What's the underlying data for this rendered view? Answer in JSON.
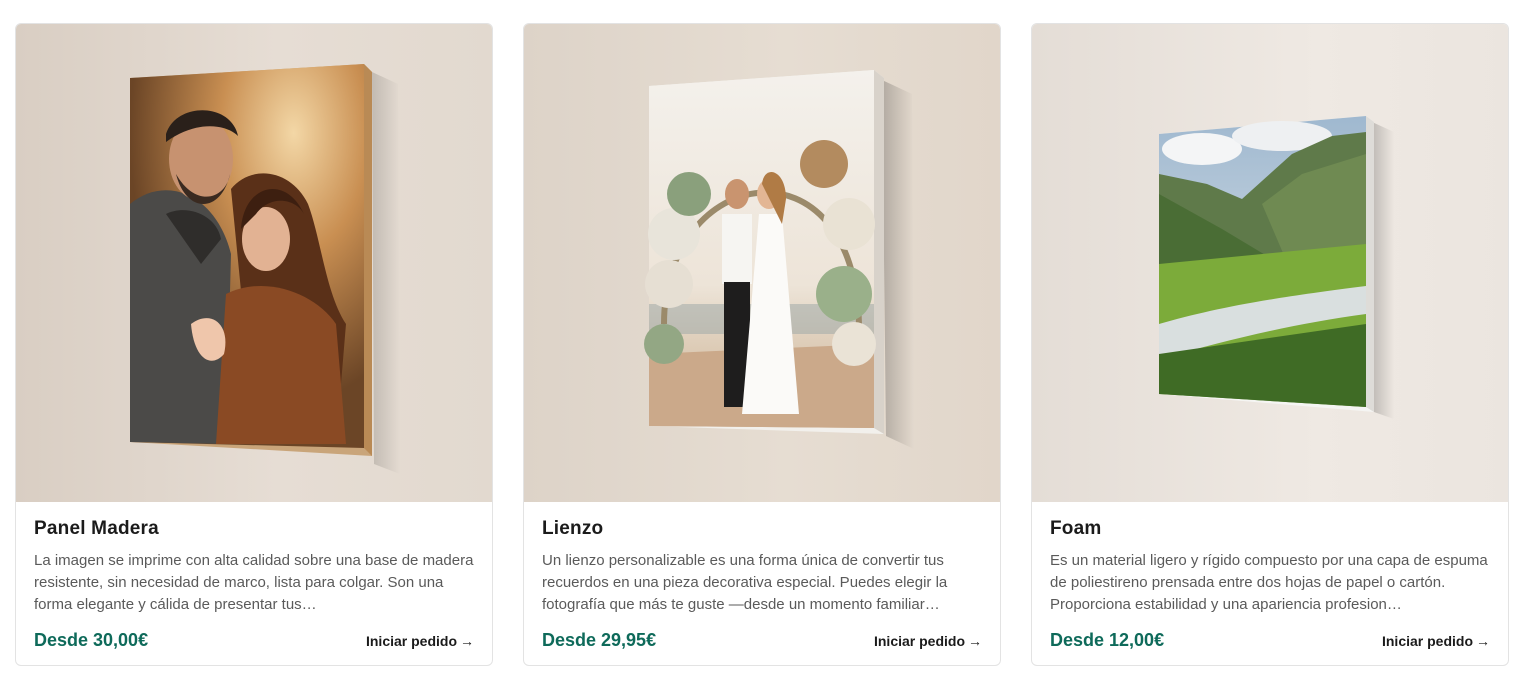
{
  "products": [
    {
      "title": "Panel Madera",
      "description": "La imagen se imprime con alta calidad sobre una base de madera resistente, sin necesidad de marco, lista para colgar. Son una forma elegante y cálida de presentar tus…",
      "price": "Desde 30,00€",
      "cta": "Iniciar pedido",
      "arrow": "→",
      "photo": "couple-embrace-autumn"
    },
    {
      "title": "Lienzo",
      "description": "Un lienzo personalizable es una forma única de convertir tus recuerdos en una pieza decorativa especial. Puedes elegir la fotografía que más te guste —desde un momento familiar…",
      "price": "Desde 29,95€",
      "cta": "Iniciar pedido",
      "arrow": "→",
      "photo": "wedding-floral-arch-beach"
    },
    {
      "title": "Foam",
      "description": "Es un material ligero y rígido compuesto por una capa de espuma de poliestireno prensada entre dos hojas de papel o cartón. Proporciona estabilidad y una apariencia profesion…",
      "price": "Desde 12,00€",
      "cta": "Iniciar pedido",
      "arrow": "→",
      "photo": "mountain-valley-river"
    }
  ],
  "colors": {
    "price": "#0e6a5a",
    "title": "#1b1b1b",
    "description": "#5a5a5a",
    "border": "#e3e3e3"
  }
}
